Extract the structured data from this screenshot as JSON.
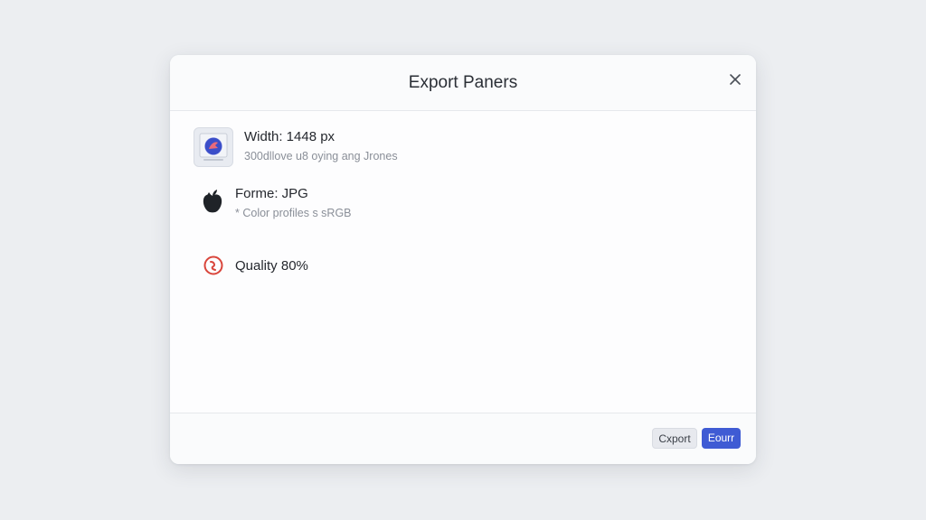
{
  "dialog": {
    "title": "Export Paners",
    "close_icon": "close-icon"
  },
  "rows": [
    {
      "icon": "image-thumbnail-icon",
      "title": "Width: 1448 px",
      "subtitle": "300dllove u8 oying ang Jrones"
    },
    {
      "icon": "apple-icon",
      "title": "Forme: JPG",
      "subtitle": "* Color profiles s sRGB"
    },
    {
      "icon": "quality-icon",
      "title": "Quality 80%",
      "subtitle": ""
    }
  ],
  "footer": {
    "secondary_label": "Cxport",
    "primary_label": "Eourr"
  },
  "colors": {
    "primary": "#3f5bd4",
    "quality_icon": "#d9453b",
    "thumb_icon": "#3b4ec9"
  }
}
